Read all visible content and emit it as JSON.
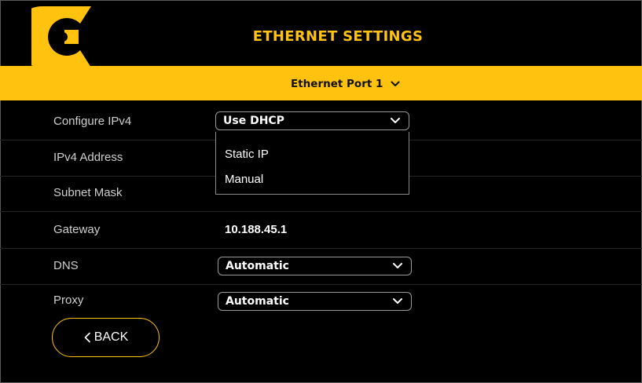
{
  "header": {
    "title": "ETHERNET SETTINGS",
    "logo_icon": "c-logo-icon",
    "accent_color": "#ffc20e"
  },
  "port": {
    "selected": "Ethernet Port 1",
    "icon": "chevron-down-icon"
  },
  "settings": {
    "configure_ipv4": {
      "label": "Configure IPv4",
      "selected": "Use DHCP",
      "options": [
        "Static IP",
        "Manual"
      ]
    },
    "ipv4_address": {
      "label": "IPv4 Address"
    },
    "subnet_mask": {
      "label": "Subnet Mask"
    },
    "gateway": {
      "label": "Gateway",
      "value": "10.188.45.1"
    },
    "dns": {
      "label": "DNS",
      "selected": "Automatic"
    },
    "proxy": {
      "label": "Proxy",
      "selected": "Automatic"
    }
  },
  "back_button": {
    "label": "BACK",
    "icon": "chevron-left-icon"
  }
}
